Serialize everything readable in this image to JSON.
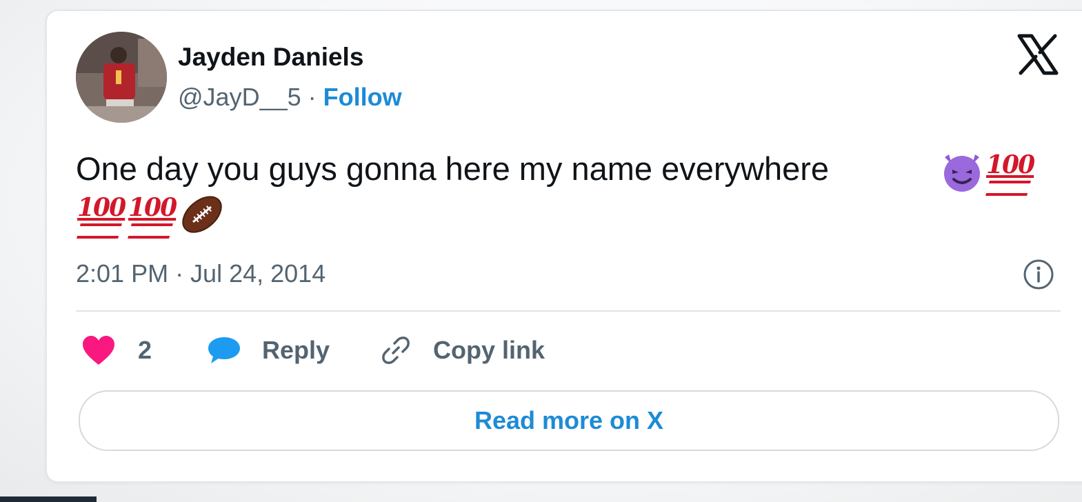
{
  "tweet": {
    "author_name": "Jayden Daniels",
    "handle": "@JayD__5",
    "separator": "·",
    "follow_label": "Follow",
    "text": "One day you guys gonna here my name everywhere",
    "emoji_hundred": "100",
    "emojis": [
      "smiling-imp",
      "hundred-points",
      "hundred-points",
      "hundred-points",
      "american-football"
    ],
    "timestamp": "2:01 PM · Jul 24, 2014"
  },
  "actions": {
    "like_count": "2",
    "reply_label": "Reply",
    "copy_link_label": "Copy link"
  },
  "footer": {
    "read_more_label": "Read more on X"
  },
  "colors": {
    "accent_blue": "#1d8bd6",
    "like_pink": "#f91880",
    "reply_blue": "#1d9bf0",
    "muted_text": "#536471",
    "primary_text": "#0f1419"
  }
}
